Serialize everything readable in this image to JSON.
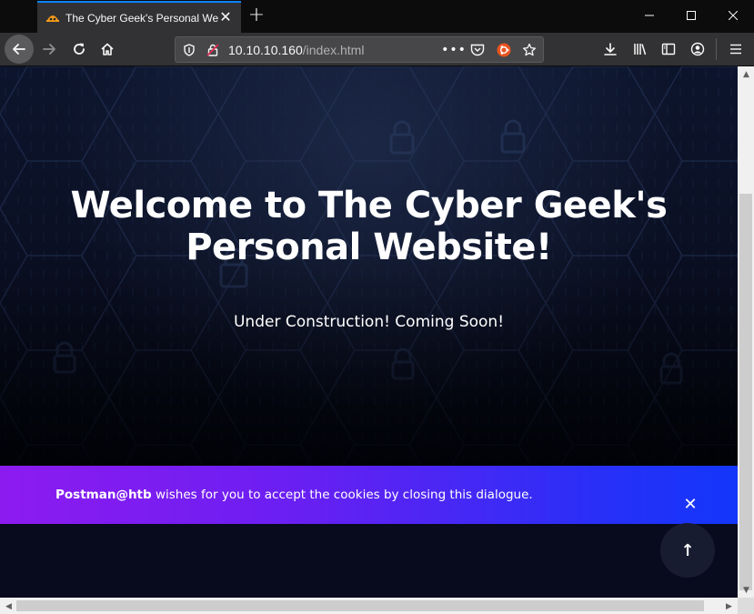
{
  "browser": {
    "tab_title": "The Cyber Geek's Personal Website",
    "url_host": "10.10.10.160",
    "url_path": "/index.html"
  },
  "hero": {
    "title_line1": "Welcome to The Cyber Geek's",
    "title_line2": "Personal Website!",
    "subtitle": "Under Construction! Coming Soon!"
  },
  "cookie_banner": {
    "user": "Postman@htb",
    "message": " wishes for you to accept the cookies by closing this dialogue.",
    "close_symbol": "✕"
  },
  "back_to_top": {
    "symbol": "↑"
  },
  "colors": {
    "banner_start": "#8d1bf0",
    "banner_end": "#1336fa",
    "page_bg": "#080b1e",
    "chrome_bg": "#323234",
    "accent": "#0a84ff"
  }
}
